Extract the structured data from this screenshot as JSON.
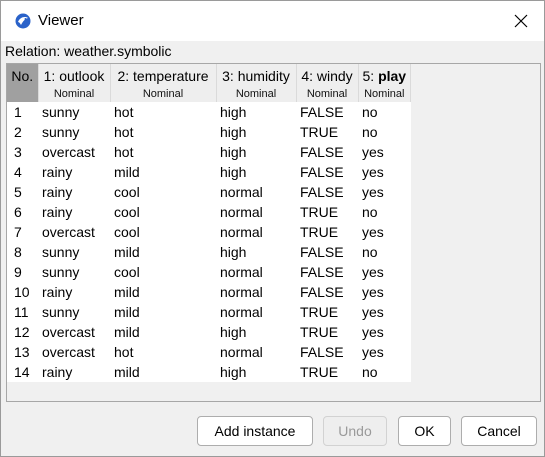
{
  "window": {
    "title": "Viewer",
    "icon": "weka-bird-icon",
    "close_icon": "close-icon"
  },
  "relation_label": "Relation: weather.symbolic",
  "table": {
    "no_header": "No.",
    "columns": [
      {
        "name": "1: outlook",
        "type": "Nominal",
        "bold": false
      },
      {
        "name": "2: temperature",
        "type": "Nominal",
        "bold": false
      },
      {
        "name": "3: humidity",
        "type": "Nominal",
        "bold": false
      },
      {
        "name": "4: windy",
        "type": "Nominal",
        "bold": false
      },
      {
        "name_prefix": "5: ",
        "name": "play",
        "type": "Nominal",
        "bold": true
      }
    ],
    "rows": [
      [
        "1",
        "sunny",
        "hot",
        "high",
        "FALSE",
        "no"
      ],
      [
        "2",
        "sunny",
        "hot",
        "high",
        "TRUE",
        "no"
      ],
      [
        "3",
        "overcast",
        "hot",
        "high",
        "FALSE",
        "yes"
      ],
      [
        "4",
        "rainy",
        "mild",
        "high",
        "FALSE",
        "yes"
      ],
      [
        "5",
        "rainy",
        "cool",
        "normal",
        "FALSE",
        "yes"
      ],
      [
        "6",
        "rainy",
        "cool",
        "normal",
        "TRUE",
        "no"
      ],
      [
        "7",
        "overcast",
        "cool",
        "normal",
        "TRUE",
        "yes"
      ],
      [
        "8",
        "sunny",
        "mild",
        "high",
        "FALSE",
        "no"
      ],
      [
        "9",
        "sunny",
        "cool",
        "normal",
        "FALSE",
        "yes"
      ],
      [
        "10",
        "rainy",
        "mild",
        "normal",
        "FALSE",
        "yes"
      ],
      [
        "11",
        "sunny",
        "mild",
        "normal",
        "TRUE",
        "yes"
      ],
      [
        "12",
        "overcast",
        "mild",
        "high",
        "TRUE",
        "yes"
      ],
      [
        "13",
        "overcast",
        "hot",
        "normal",
        "FALSE",
        "yes"
      ],
      [
        "14",
        "rainy",
        "mild",
        "high",
        "TRUE",
        "no"
      ]
    ]
  },
  "buttons": {
    "add_instance": "Add instance",
    "undo": "Undo",
    "ok": "OK",
    "cancel": "Cancel"
  }
}
